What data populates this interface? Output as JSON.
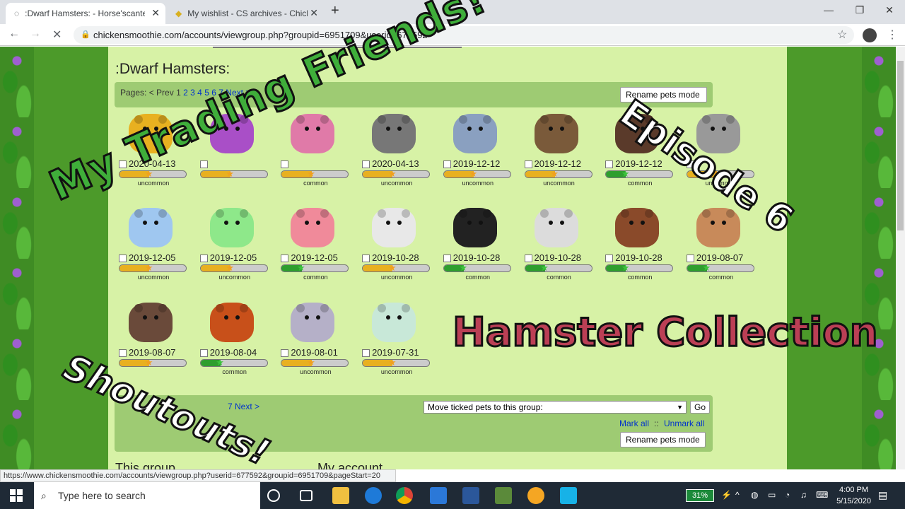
{
  "browser": {
    "tabs": [
      {
        "label": ":Dwarf Hamsters: - Horse'scanter",
        "active": true
      },
      {
        "label": "My wishlist - CS archives - Chicke",
        "active": false
      }
    ],
    "new_tab_glyph": "+",
    "url": "chickensmoothie.com/accounts/viewgroup.php?groupid=6951709&userid=677592",
    "status_url": "https://www.chickensmoothie.com/accounts/viewgroup.php?userid=677592&groupid=6951709&pageStart=20",
    "icons": [
      "back-icon",
      "forward-icon",
      "reload-icon",
      "lock-icon",
      "star-icon"
    ]
  },
  "group": {
    "title": ":Dwarf Hamsters:",
    "pages_label": "Pages:",
    "prev": "< Prev",
    "current_page": "1",
    "page_links": [
      "2",
      "3",
      "4",
      "5",
      "6",
      "7"
    ],
    "next": "Next >",
    "rename_label": "Rename pets mode",
    "rename_label_top_visible": "Rename",
    "rename_label_top_tail": "mode",
    "move_select": "Move ticked pets to this group:",
    "go_label": "Go",
    "mark_all": "Mark all",
    "separator": "::",
    "unmark_all": "Unmark all",
    "footer_left": "This group",
    "footer_right": "My account",
    "bottom_pages_partial": "7 Next >"
  },
  "pets": [
    {
      "date": "2020-04-13",
      "rarity": "uncommon",
      "color": "#e8b020",
      "bar": "#e8b020",
      "fill": 0.45
    },
    {
      "date": "",
      "rarity": "",
      "color": "#a94fc7",
      "bar": "#e8b020",
      "fill": 0.45
    },
    {
      "date": "",
      "rarity": "common",
      "color": "#e07aa8",
      "bar": "#e8b020",
      "fill": 0.45
    },
    {
      "date": "2020-04-13",
      "rarity": "uncommon",
      "color": "#777777",
      "bar": "#e8b020",
      "fill": 0.45
    },
    {
      "date": "2019-12-12",
      "rarity": "uncommon",
      "color": "#8aa0c0",
      "bar": "#e8b020",
      "fill": 0.45
    },
    {
      "date": "2019-12-12",
      "rarity": "uncommon",
      "color": "#7a5a3a",
      "bar": "#e8b020",
      "fill": 0.45
    },
    {
      "date": "2019-12-12",
      "rarity": "common",
      "color": "#5a3a2a",
      "bar": "#2e9e2e",
      "fill": 0.3
    },
    {
      "date": "",
      "rarity": "uncommon",
      "color": "#999999",
      "bar": "#e8b020",
      "fill": 0.45
    },
    {
      "date": "2019-12-05",
      "rarity": "uncommon",
      "color": "#9fc7f0",
      "bar": "#e8b020",
      "fill": 0.45
    },
    {
      "date": "2019-12-05",
      "rarity": "uncommon",
      "color": "#8ee88a",
      "bar": "#e8b020",
      "fill": 0.45
    },
    {
      "date": "2019-12-05",
      "rarity": "common",
      "color": "#f08a9a",
      "bar": "#2e9e2e",
      "fill": 0.3
    },
    {
      "date": "2019-10-28",
      "rarity": "uncommon",
      "color": "#e8e8e8",
      "bar": "#e8b020",
      "fill": 0.45
    },
    {
      "date": "2019-10-28",
      "rarity": "common",
      "color": "#222222",
      "bar": "#2e9e2e",
      "fill": 0.3
    },
    {
      "date": "2019-10-28",
      "rarity": "common",
      "color": "#dcdcdc",
      "bar": "#2e9e2e",
      "fill": 0.3
    },
    {
      "date": "2019-10-28",
      "rarity": "common",
      "color": "#8a4a2a",
      "bar": "#2e9e2e",
      "fill": 0.3
    },
    {
      "date": "2019-08-07",
      "rarity": "common",
      "color": "#c88a5a",
      "bar": "#2e9e2e",
      "fill": 0.3
    },
    {
      "date": "2019-08-07",
      "rarity": "",
      "color": "#6a4a3a",
      "bar": "#e8b020",
      "fill": 0.45
    },
    {
      "date": "2019-08-04",
      "rarity": "common",
      "color": "#c8501a",
      "bar": "#2e9e2e",
      "fill": 0.3
    },
    {
      "date": "2019-08-01",
      "rarity": "uncommon",
      "color": "#b5b0c8",
      "bar": "#e8b020",
      "fill": 0.45
    },
    {
      "date": "2019-07-31",
      "rarity": "uncommon",
      "color": "#c8e8d8",
      "bar": "#e8b020",
      "fill": 0.45
    }
  ],
  "overlay": {
    "trading": "My Trading Friends!",
    "episode": "Episode 6",
    "hamster": "Hamster Collection",
    "shoutouts": "Shoutouts!"
  },
  "taskbar": {
    "search_placeholder": "Type here to search",
    "battery": "31%",
    "time": "4:00 PM",
    "date": "5/15/2020",
    "icons": [
      "windows-icon",
      "cortana-icon",
      "task-view-icon",
      "file-explorer-icon",
      "edge-icon",
      "chrome-icon",
      "mail-icon",
      "word-icon",
      "minecraft-icon",
      "app-icon",
      "kodi-icon"
    ]
  }
}
